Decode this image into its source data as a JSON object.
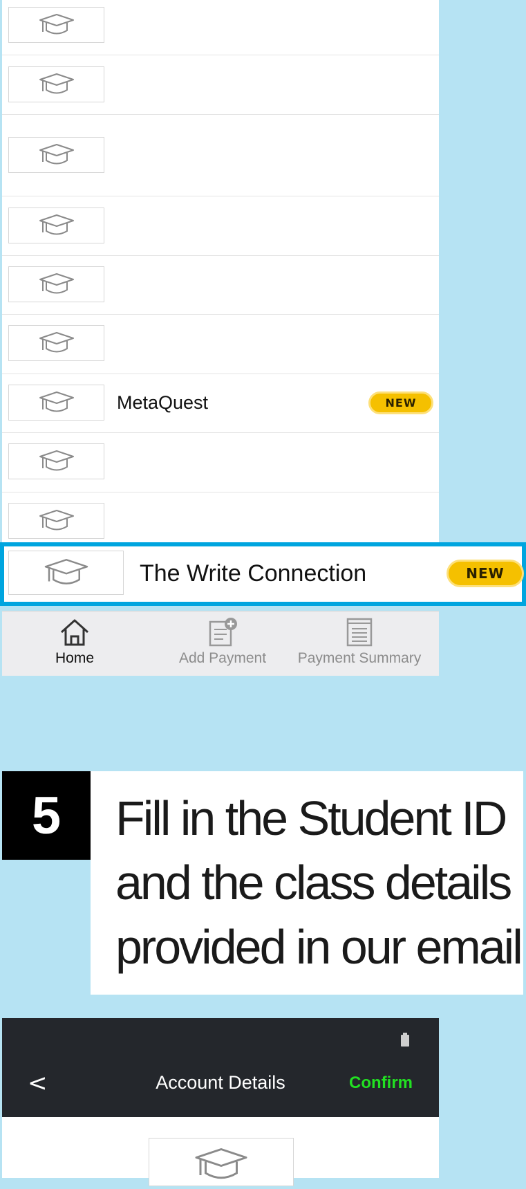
{
  "schools": [
    {
      "name": "",
      "new": false
    },
    {
      "name": "",
      "new": false
    },
    {
      "name": "",
      "new": false
    },
    {
      "name": "",
      "new": false
    },
    {
      "name": "",
      "new": false
    },
    {
      "name": "",
      "new": false
    },
    {
      "name": "MetaQuest",
      "new": true
    },
    {
      "name": "",
      "new": false
    },
    {
      "name": "",
      "new": false
    }
  ],
  "badge_label": "NEW",
  "highlighted_school": {
    "name": "The Write Connection",
    "badge": "NEW"
  },
  "tabbar": {
    "home": "Home",
    "add_payment": "Add Payment",
    "payment_summary": "Payment Summary"
  },
  "step": {
    "number": "5",
    "lines": [
      "Fill in the Student ID",
      "and the class details",
      "provided in our email"
    ]
  },
  "account_screen": {
    "back": "<",
    "title": "Account Details",
    "confirm": "Confirm"
  },
  "icons": [
    "graduation-cap-icon",
    "home-icon",
    "add-payment-icon",
    "payment-summary-icon",
    "battery-icon",
    "back-icon"
  ],
  "colors": {
    "background": "#b6e3f3",
    "highlight": "#00a5df",
    "badge": "#f5c000",
    "confirm": "#22e022",
    "header": "#24272c"
  }
}
